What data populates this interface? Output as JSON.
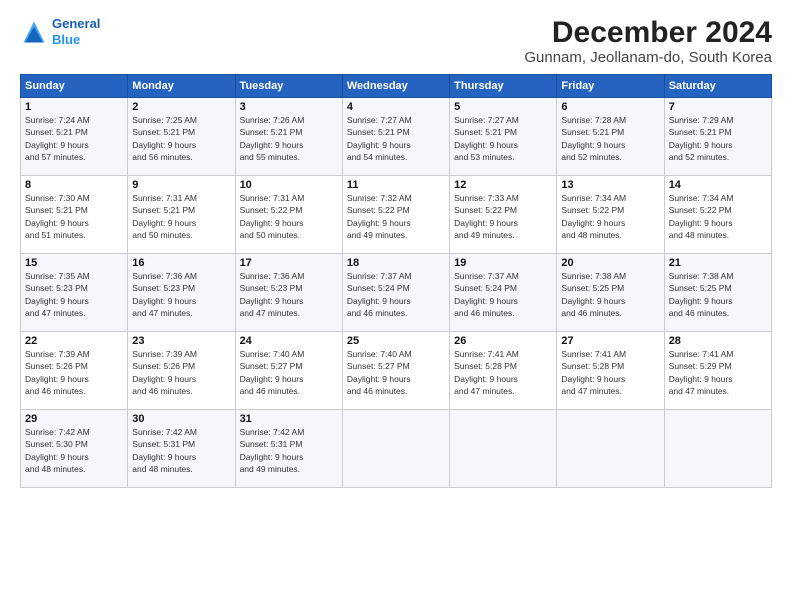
{
  "header": {
    "logo_line1": "General",
    "logo_line2": "Blue",
    "title": "December 2024",
    "subtitle": "Gunnam, Jeollanam-do, South Korea"
  },
  "weekdays": [
    "Sunday",
    "Monday",
    "Tuesday",
    "Wednesday",
    "Thursday",
    "Friday",
    "Saturday"
  ],
  "weeks": [
    [
      {
        "day": "1",
        "sunrise": "7:24 AM",
        "sunset": "5:21 PM",
        "daylight": "9 hours and 57 minutes."
      },
      {
        "day": "2",
        "sunrise": "7:25 AM",
        "sunset": "5:21 PM",
        "daylight": "9 hours and 56 minutes."
      },
      {
        "day": "3",
        "sunrise": "7:26 AM",
        "sunset": "5:21 PM",
        "daylight": "9 hours and 55 minutes."
      },
      {
        "day": "4",
        "sunrise": "7:27 AM",
        "sunset": "5:21 PM",
        "daylight": "9 hours and 54 minutes."
      },
      {
        "day": "5",
        "sunrise": "7:27 AM",
        "sunset": "5:21 PM",
        "daylight": "9 hours and 53 minutes."
      },
      {
        "day": "6",
        "sunrise": "7:28 AM",
        "sunset": "5:21 PM",
        "daylight": "9 hours and 52 minutes."
      },
      {
        "day": "7",
        "sunrise": "7:29 AM",
        "sunset": "5:21 PM",
        "daylight": "9 hours and 52 minutes."
      }
    ],
    [
      {
        "day": "8",
        "sunrise": "7:30 AM",
        "sunset": "5:21 PM",
        "daylight": "9 hours and 51 minutes."
      },
      {
        "day": "9",
        "sunrise": "7:31 AM",
        "sunset": "5:21 PM",
        "daylight": "9 hours and 50 minutes."
      },
      {
        "day": "10",
        "sunrise": "7:31 AM",
        "sunset": "5:22 PM",
        "daylight": "9 hours and 50 minutes."
      },
      {
        "day": "11",
        "sunrise": "7:32 AM",
        "sunset": "5:22 PM",
        "daylight": "9 hours and 49 minutes."
      },
      {
        "day": "12",
        "sunrise": "7:33 AM",
        "sunset": "5:22 PM",
        "daylight": "9 hours and 49 minutes."
      },
      {
        "day": "13",
        "sunrise": "7:34 AM",
        "sunset": "5:22 PM",
        "daylight": "9 hours and 48 minutes."
      },
      {
        "day": "14",
        "sunrise": "7:34 AM",
        "sunset": "5:22 PM",
        "daylight": "9 hours and 48 minutes."
      }
    ],
    [
      {
        "day": "15",
        "sunrise": "7:35 AM",
        "sunset": "5:23 PM",
        "daylight": "9 hours and 47 minutes."
      },
      {
        "day": "16",
        "sunrise": "7:36 AM",
        "sunset": "5:23 PM",
        "daylight": "9 hours and 47 minutes."
      },
      {
        "day": "17",
        "sunrise": "7:36 AM",
        "sunset": "5:23 PM",
        "daylight": "9 hours and 47 minutes."
      },
      {
        "day": "18",
        "sunrise": "7:37 AM",
        "sunset": "5:24 PM",
        "daylight": "9 hours and 46 minutes."
      },
      {
        "day": "19",
        "sunrise": "7:37 AM",
        "sunset": "5:24 PM",
        "daylight": "9 hours and 46 minutes."
      },
      {
        "day": "20",
        "sunrise": "7:38 AM",
        "sunset": "5:25 PM",
        "daylight": "9 hours and 46 minutes."
      },
      {
        "day": "21",
        "sunrise": "7:38 AM",
        "sunset": "5:25 PM",
        "daylight": "9 hours and 46 minutes."
      }
    ],
    [
      {
        "day": "22",
        "sunrise": "7:39 AM",
        "sunset": "5:26 PM",
        "daylight": "9 hours and 46 minutes."
      },
      {
        "day": "23",
        "sunrise": "7:39 AM",
        "sunset": "5:26 PM",
        "daylight": "9 hours and 46 minutes."
      },
      {
        "day": "24",
        "sunrise": "7:40 AM",
        "sunset": "5:27 PM",
        "daylight": "9 hours and 46 minutes."
      },
      {
        "day": "25",
        "sunrise": "7:40 AM",
        "sunset": "5:27 PM",
        "daylight": "9 hours and 46 minutes."
      },
      {
        "day": "26",
        "sunrise": "7:41 AM",
        "sunset": "5:28 PM",
        "daylight": "9 hours and 47 minutes."
      },
      {
        "day": "27",
        "sunrise": "7:41 AM",
        "sunset": "5:28 PM",
        "daylight": "9 hours and 47 minutes."
      },
      {
        "day": "28",
        "sunrise": "7:41 AM",
        "sunset": "5:29 PM",
        "daylight": "9 hours and 47 minutes."
      }
    ],
    [
      {
        "day": "29",
        "sunrise": "7:42 AM",
        "sunset": "5:30 PM",
        "daylight": "9 hours and 48 minutes."
      },
      {
        "day": "30",
        "sunrise": "7:42 AM",
        "sunset": "5:31 PM",
        "daylight": "9 hours and 48 minutes."
      },
      {
        "day": "31",
        "sunrise": "7:42 AM",
        "sunset": "5:31 PM",
        "daylight": "9 hours and 49 minutes."
      },
      null,
      null,
      null,
      null
    ]
  ]
}
